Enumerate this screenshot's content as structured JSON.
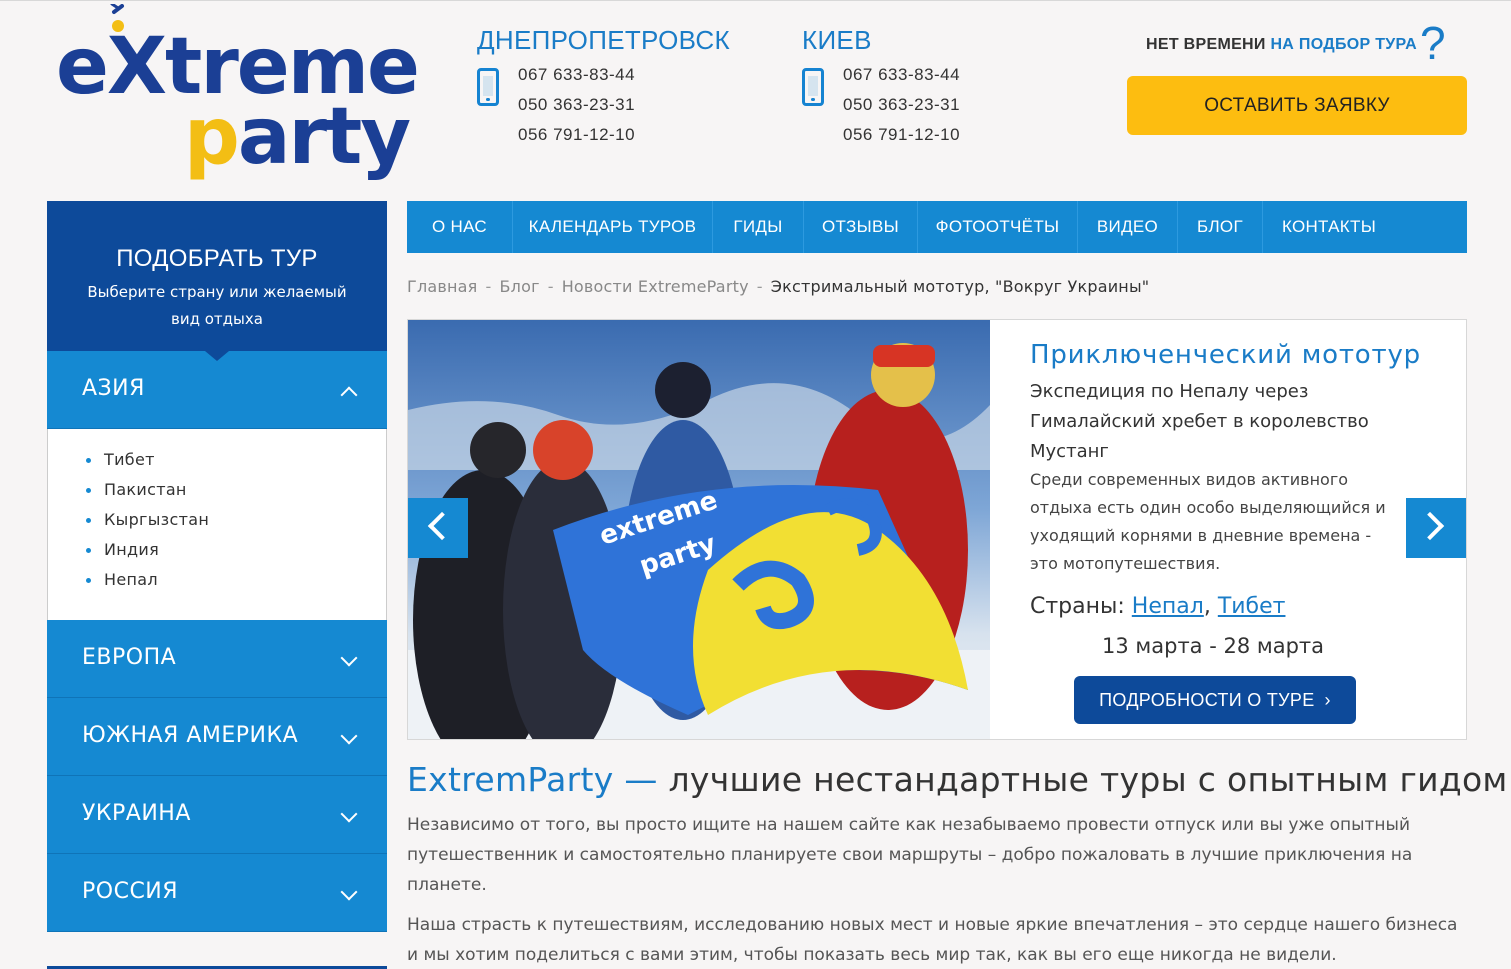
{
  "logo": {
    "part1": "e",
    "part2": "treme",
    "part3": "p",
    "part4": "arty",
    "x": "X"
  },
  "contacts": {
    "dnepr": {
      "city": "ДНЕПРОПЕТРОВСК",
      "phones": [
        "067 633-83-44",
        "050 363-23-31",
        "056 791-12-10"
      ]
    },
    "kiev": {
      "city": "КИЕВ",
      "phones": [
        "067 633-83-44",
        "050 363-23-31",
        "056 791-12-10"
      ]
    }
  },
  "request": {
    "prefix": "НЕТ ВРЕМЕНИ",
    "link": "НА ПОДБОР ТУРА",
    "qmark": "?",
    "button": "ОСТАВИТЬ ЗАЯВКУ"
  },
  "nav": {
    "items": [
      "О НАС",
      "КАЛЕНДАРЬ ТУРОВ",
      "ГИДЫ",
      "ОТЗЫВЫ",
      "ФОТООТЧЁТЫ",
      "ВИДЕО",
      "БЛОГ",
      "КОНТАКТЫ"
    ]
  },
  "sidebar": {
    "title": "ПОДОБРАТЬ ТУР",
    "subtitle": "Выберите страну или желаемый вид отдыха",
    "categories": [
      {
        "label": "АЗИЯ",
        "expanded": true,
        "items": [
          "Тибет",
          "Пакистан",
          "Кыргызстан",
          "Индия",
          "Непал"
        ]
      },
      {
        "label": "ЕВРОПА",
        "expanded": false
      },
      {
        "label": "ЮЖНАЯ АМЕРИКА",
        "expanded": false
      },
      {
        "label": "УКРАИНА",
        "expanded": false
      },
      {
        "label": "РОССИЯ",
        "expanded": false
      }
    ]
  },
  "breadcrumb": {
    "items": [
      "Главная",
      "Блог",
      "Новости ExtremeParty"
    ],
    "current": "Экстримальный мототур, \"Вокруг Украины\"",
    "sep": "-"
  },
  "slider": {
    "title": "Приключенческий мототур",
    "subtitle": "Экспедиция по Непалу через Гималайский хребет в королевство Мустанг",
    "description": "Среди современных видов активного отдыха есть один особо выделяющийся и уходящий корнями в дневние времена - это мотопутешествия.",
    "countries_label": "Страны:",
    "countries": [
      "Непал",
      "Тибет"
    ],
    "dates": "13 марта - 28 марта",
    "button": "ПОДРОБНОСТИ О ТУРЕ",
    "flag_text1": "extreme",
    "flag_text2": "party"
  },
  "content": {
    "heading_brand": "ExtremParty —",
    "heading_rest": " лучшие нестандартные туры с опытным гидом",
    "para1": "Независимо от того, вы просто ищите на нашем сайте как незабываемо провести отпуск или вы уже опытный путешественник и самостоятельно планируете свои маршруты – добро пожаловать в лучшие приключения на планете.",
    "para2": "Наша страсть к путешествиям, исследованию новых мест и новые яркие впечатления – это сердце нашего бизнеса и мы хотим поделиться с вами этим, чтобы показать весь мир так, как вы его еще никогда не видели."
  },
  "colors": {
    "primary": "#1589d2",
    "dark": "#0d4a9a",
    "accent": "#fdbd10",
    "link": "#1a7cc7"
  }
}
